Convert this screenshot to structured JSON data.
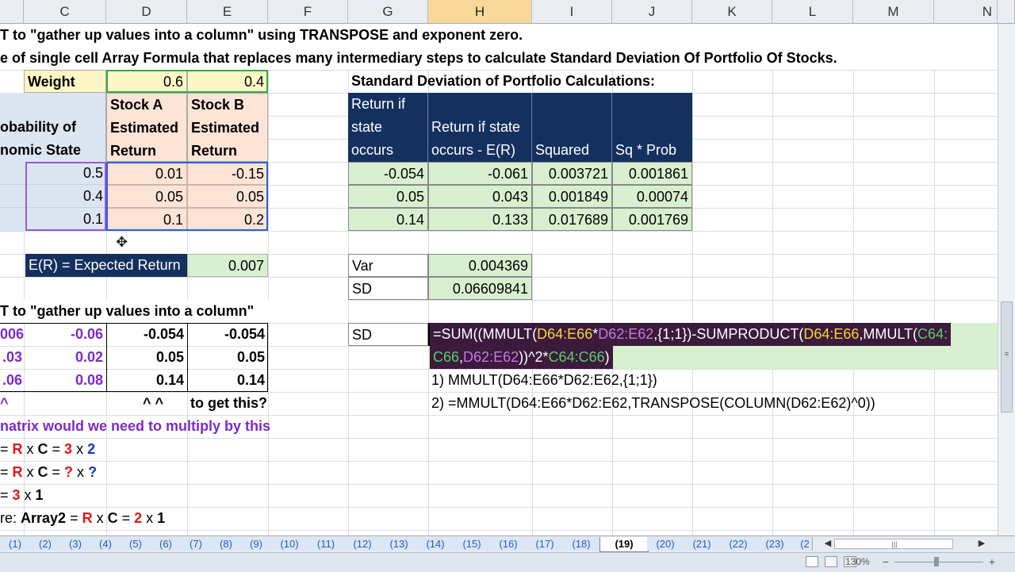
{
  "columns": {
    "c": "C",
    "d": "D",
    "e": "E",
    "f": "F",
    "g": "G",
    "h": "H",
    "i": "I",
    "j": "J",
    "k": "K",
    "l": "L",
    "m": "M",
    "n": "N"
  },
  "rows": {
    "row1_text": "T to \"gather up values into a column\" using TRANSPOSE and exponent zero.",
    "row2_text": "e of single cell Array Formula that replaces many intermediary steps to calculate Standard Deviation Of Portfolio Of Stocks."
  },
  "weights": {
    "label": "Weight",
    "d": "0.6",
    "e": "0.4"
  },
  "left_table": {
    "c_header": [
      "",
      "obability of",
      "nomic State"
    ],
    "d_header": [
      "Stock A",
      "Estimated",
      "Return"
    ],
    "e_header": [
      "Stock B",
      "Estimated",
      "Return"
    ],
    "rows": [
      {
        "c": "0.5",
        "d": "0.01",
        "e": "-0.15"
      },
      {
        "c": "0.4",
        "d": "0.05",
        "e": "0.05"
      },
      {
        "c": "0.1",
        "d": "0.1",
        "e": "0.2"
      }
    ]
  },
  "expected_return": {
    "label": "E(R) = Expected Return",
    "value": "0.007"
  },
  "right_title": "Standard Deviation of Portfolio Calculations:",
  "right_table": {
    "headers": [
      [
        "Return if",
        "state",
        "occurs"
      ],
      [
        "",
        "Return if state",
        "occurs - E(R)"
      ],
      [
        "",
        "",
        "Squared"
      ],
      [
        "",
        "",
        "Sq * Prob"
      ]
    ],
    "rows": [
      [
        "-0.054",
        "-0.061",
        "0.003721",
        "0.001861"
      ],
      [
        "0.05",
        "0.043",
        "0.001849",
        "0.00074"
      ],
      [
        "0.14",
        "0.133",
        "0.017689",
        "0.001769"
      ]
    ]
  },
  "var_sd": {
    "var_label": "Var",
    "var_value": "0.004369",
    "sd_label": "SD",
    "sd_value": "0.06609841",
    "sd2_label": "SD"
  },
  "formula": {
    "p1": "=SUM((MMULT(",
    "p2": "D64:E66",
    "p3": "*",
    "p4": "D62:E62",
    "p5": ",{1;1})-SUMPRODUCT(",
    "p6": "D64:E66",
    "p7": ",MMULT(",
    "p8": "C64:",
    "q1": "C66",
    "q2": ",",
    "q3": "D62:E62",
    "q4": "))^2*",
    "q5": "C64:C66",
    "q6": ")"
  },
  "notes": {
    "n1": "1) MMULT(D64:E66*D62:E62,{1;1})",
    "n2": "2) =MMULT(D64:E66*D62:E62,TRANSPOSE(COLUMN(D62:E62)^0))"
  },
  "section2_title": "T to \"gather up values into a column\"",
  "lower_table": [
    [
      "006",
      "-0.06",
      "-0.054",
      "-0.054"
    ],
    [
      ".03",
      "0.02",
      "0.05",
      "0.05"
    ],
    [
      ".06",
      "0.08",
      "0.14",
      "0.14"
    ]
  ],
  "carets": {
    "b": "^",
    "d": "^   ^",
    "e": "to get this?"
  },
  "matrix_text": "natrix would we need to multiply by this",
  "eq1": {
    "a": "= ",
    "r": "R",
    "x1": " x ",
    "c": "C",
    "eq": " = ",
    "n1": "3",
    "x2": " x ",
    "n2": "2"
  },
  "eq2": {
    "a": "= ",
    "r": "R",
    "x1": " x ",
    "c": "C",
    "eq": " = ",
    "n1": "?",
    "x2": " x ",
    "n2": "?"
  },
  "eq3": {
    "a": "= ",
    "n1": "3",
    "x2": " x ",
    "n2": "1"
  },
  "eq4": {
    "a": "re: ",
    "arr": "Array2",
    "eq0": " = ",
    "r": "R",
    "x1": " x ",
    "c": "C",
    "eq": " = ",
    "n1": "2",
    "x2": " x ",
    "n2": "1"
  },
  "sheet_tabs": [
    "(1)",
    "(2)",
    "(3)",
    "(4)",
    "(5)",
    "(6)",
    "(7)",
    "(8)",
    "(9)",
    "(10)",
    "(11)",
    "(12)",
    "(13)",
    "(14)",
    "(15)",
    "(16)",
    "(17)",
    "(18)",
    "(19)",
    "(20)",
    "(21)",
    "(22)",
    "(23)",
    "(2"
  ],
  "active_tab": "(19)",
  "zoom": "130%",
  "colors": {
    "navy": "#14305f",
    "green_fill": "#d8f0cf",
    "blue_fill": "#dce6f2",
    "salmon_fill": "#fde4d6",
    "yellow_fill": "#fdf7c5",
    "purple_text": "#7a2bc9",
    "formula_bg": "#3b1a3c"
  }
}
